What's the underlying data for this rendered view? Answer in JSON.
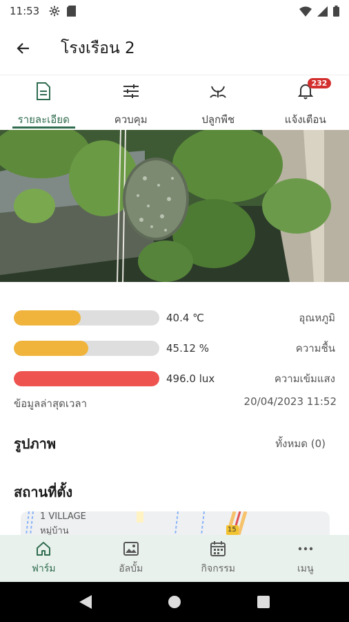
{
  "status_bar": {
    "time": "11:53",
    "icons": [
      "settings-icon",
      "sim-card-icon",
      "wifi-icon",
      "signal-icon",
      "battery-icon"
    ]
  },
  "app_bar": {
    "title": "โรงเรือน 2",
    "back_icon": "arrow-left-icon"
  },
  "tabs": [
    {
      "label": "รายละเอียด",
      "icon": "document-icon",
      "active": true
    },
    {
      "label": "ควบคุม",
      "icon": "sliders-icon",
      "active": false
    },
    {
      "label": "ปลูกพืช",
      "icon": "sprout-icon",
      "active": false
    },
    {
      "label": "แจ้งเตือน",
      "icon": "bell-icon",
      "active": false,
      "badge": "232"
    }
  ],
  "sensors": [
    {
      "label": "อุณหภูมิ",
      "value": "40.4 ℃",
      "level": 0.46,
      "color": "#f0b43c"
    },
    {
      "label": "ความชื้น",
      "value": "45.12 %",
      "level": 0.51,
      "color": "#f0b43c"
    },
    {
      "label": "ความเข้มแสง",
      "value": "496.0 lux",
      "level": 1.0,
      "color": "#ef5350"
    }
  ],
  "last_update": {
    "label": "ข้อมูลล่าสุดเวลา",
    "value": "20/04/2023 11:52"
  },
  "photos": {
    "title": "รูปภาพ",
    "all_label": "ทั้งหมด (0)"
  },
  "location": {
    "title": "สถานที่ตั้ง",
    "map_text_1": "1 VILLAGE",
    "map_text_2": "หมู่บ้าน",
    "road_sign": "15"
  },
  "bottom_nav": [
    {
      "label": "ฟาร์ม",
      "icon": "home-icon",
      "active": true
    },
    {
      "label": "อัลบั้ม",
      "icon": "image-icon",
      "active": false
    },
    {
      "label": "กิจกรรม",
      "icon": "calendar-icon",
      "active": false
    },
    {
      "label": "เมนู",
      "icon": "more-horizontal-icon",
      "active": false
    }
  ],
  "colors": {
    "accent": "#2f6b4e",
    "badge": "#d32f2f",
    "nav_bg": "#e9f1ec"
  }
}
